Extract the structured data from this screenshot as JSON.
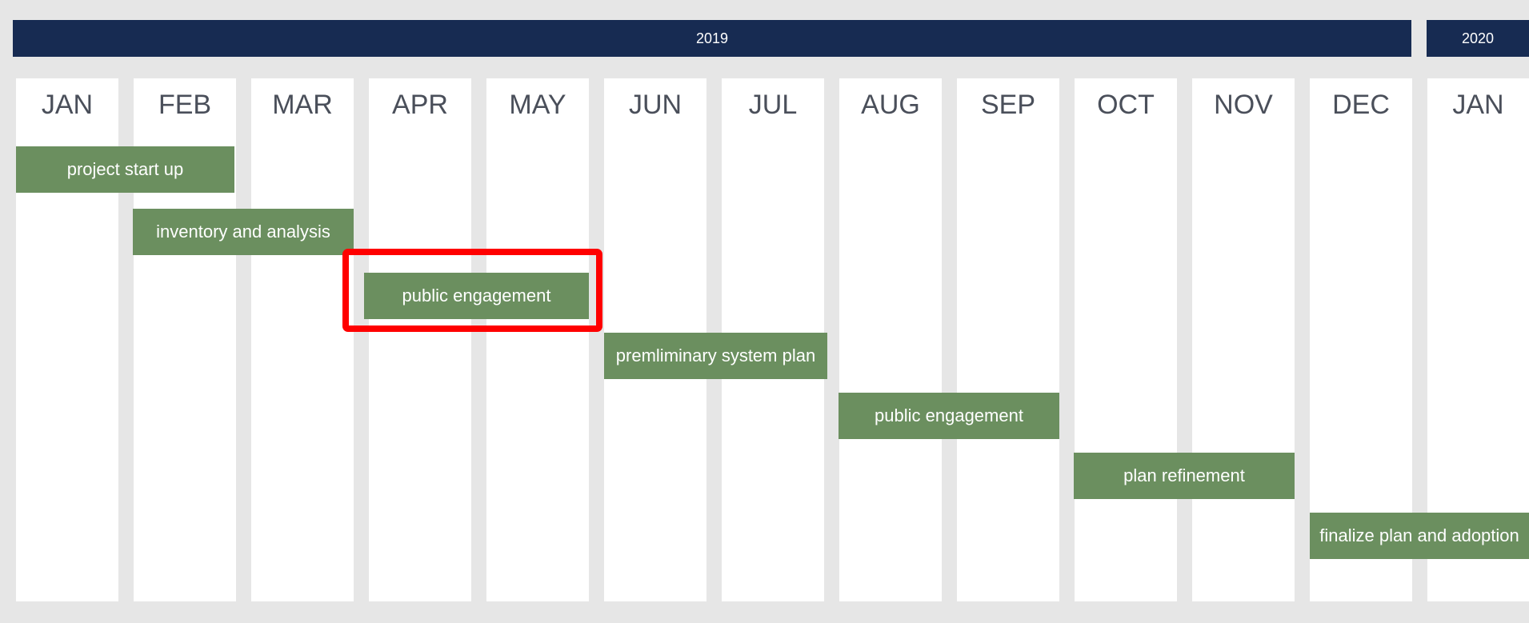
{
  "years": [
    {
      "label": "2019"
    },
    {
      "label": "2020"
    }
  ],
  "months": [
    "JAN",
    "FEB",
    "MAR",
    "APR",
    "MAY",
    "JUN",
    "JUL",
    "AUG",
    "SEP",
    "OCT",
    "NOV",
    "DEC",
    "JAN"
  ],
  "tasks": [
    {
      "label": "project start up"
    },
    {
      "label": "inventory and analysis"
    },
    {
      "label": "public engagement"
    },
    {
      "label": "premliminary system plan"
    },
    {
      "label": "public engagement"
    },
    {
      "label": "plan refinement"
    },
    {
      "label": "finalize plan and adoption"
    }
  ],
  "colors": {
    "year_bar": "#172b52",
    "task_bar": "#6b8f5f",
    "highlight": "#ff0000",
    "background": "#e6e6e6"
  }
}
